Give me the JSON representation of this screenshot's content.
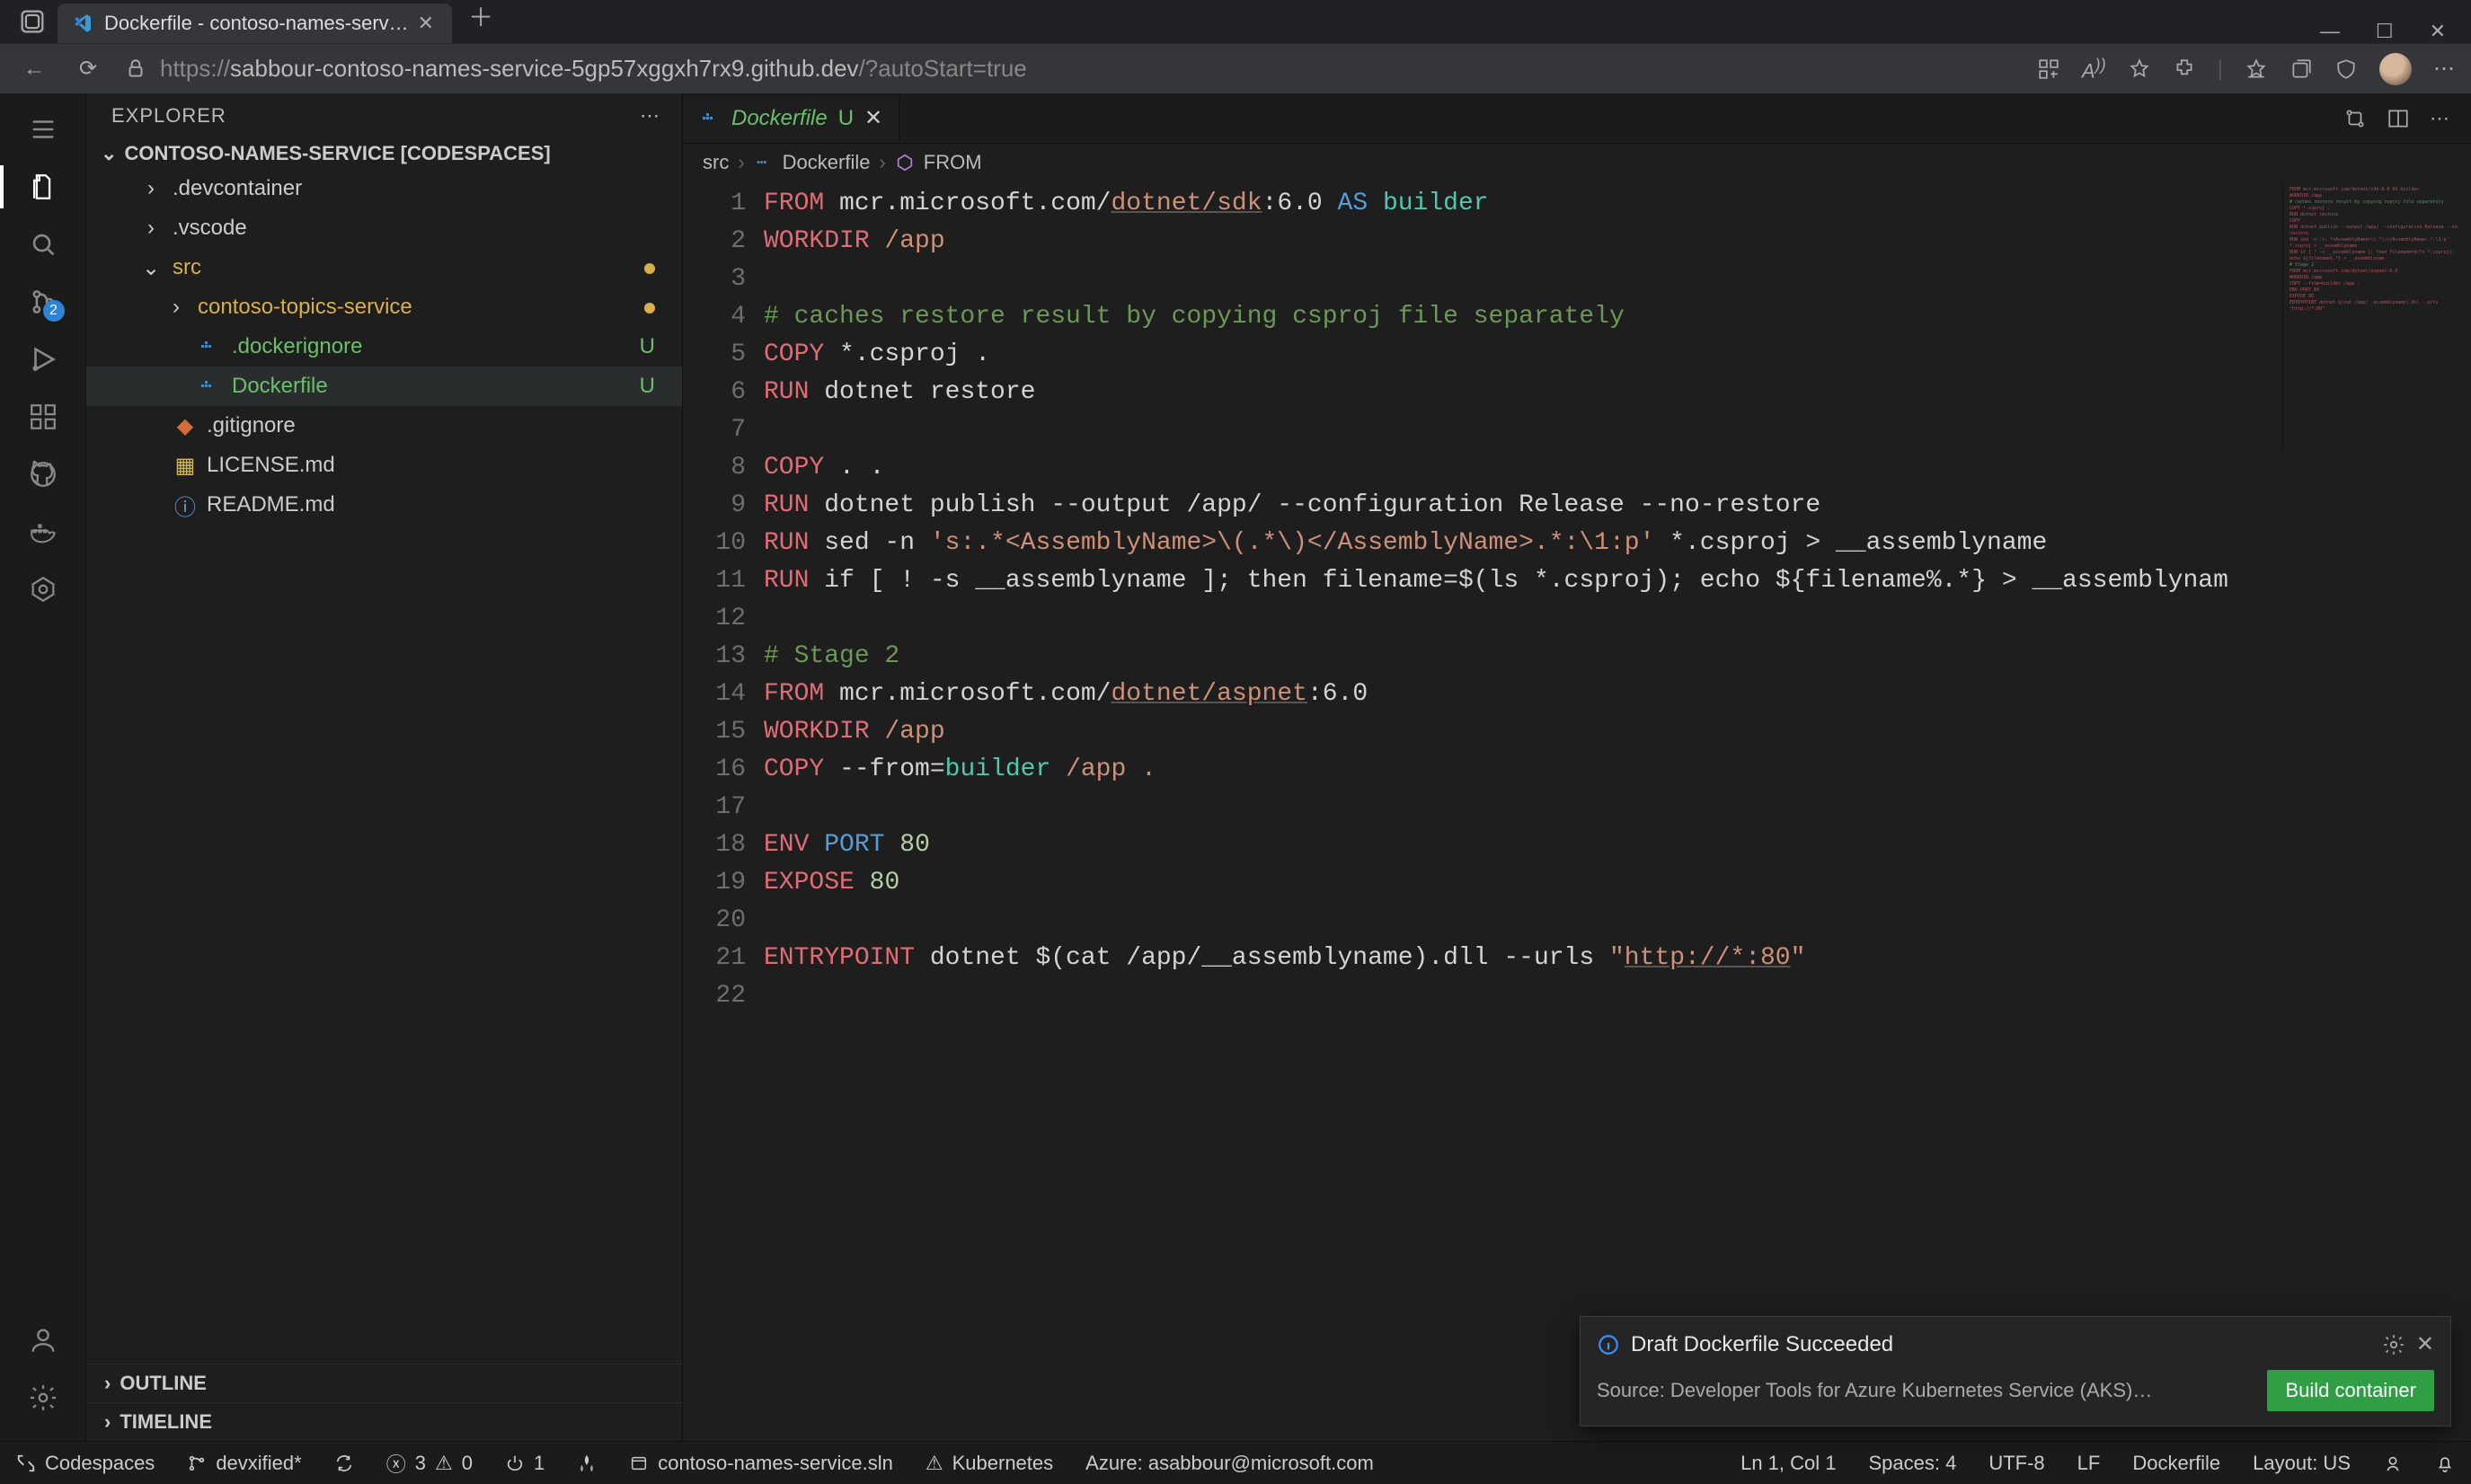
{
  "browser": {
    "tab_title": "Dockerfile - contoso-names-serv…",
    "url_prefix": "https://",
    "url_host": "sabbour-contoso-names-service-5gp57xggxh7rx9.github.dev",
    "url_path": "/?autoStart=true"
  },
  "sidebar": {
    "panel_title": "EXPLORER",
    "workspace_title": "CONTOSO-NAMES-SERVICE [CODESPACES]",
    "outline_label": "OUTLINE",
    "timeline_label": "TIMELINE",
    "tree": [
      {
        "name": ".devcontainer",
        "kind": "dir",
        "depth": 1,
        "expanded": false
      },
      {
        "name": ".vscode",
        "kind": "dir",
        "depth": 1,
        "expanded": false
      },
      {
        "name": "src",
        "kind": "dir",
        "depth": 1,
        "expanded": true,
        "status": "modified",
        "statusGlyph": "dot"
      },
      {
        "name": "contoso-topics-service",
        "kind": "dir",
        "depth": 2,
        "expanded": false,
        "status": "modified",
        "statusGlyph": "dot"
      },
      {
        "name": ".dockerignore",
        "kind": "file",
        "depth": 2,
        "status": "untracked",
        "statusGlyph": "U",
        "icon": "whale"
      },
      {
        "name": "Dockerfile",
        "kind": "file",
        "depth": 2,
        "status": "untracked",
        "statusGlyph": "U",
        "icon": "whale",
        "selected": true
      },
      {
        "name": ".gitignore",
        "kind": "file",
        "depth": 1,
        "icon": "git"
      },
      {
        "name": "LICENSE.md",
        "kind": "file",
        "depth": 1,
        "icon": "cert"
      },
      {
        "name": "README.md",
        "kind": "file",
        "depth": 1,
        "icon": "info"
      }
    ]
  },
  "source_control_badge": "2",
  "editor": {
    "tab_label": "Dockerfile",
    "tab_status": "U",
    "breadcrumb": [
      "src",
      "Dockerfile",
      "FROM"
    ]
  },
  "code": {
    "lines": [
      [
        {
          "t": "FROM",
          "c": "ins"
        },
        {
          "t": " mcr.microsoft.com/",
          "c": "op"
        },
        {
          "t": "dotnet/sdk",
          "c": "lnk"
        },
        {
          "t": ":6.0 ",
          "c": "op"
        },
        {
          "t": "AS",
          "c": "blue"
        },
        {
          "t": " ",
          "c": "op"
        },
        {
          "t": "builder",
          "c": "teal"
        }
      ],
      [
        {
          "t": "WORKDIR",
          "c": "ins"
        },
        {
          "t": " /app",
          "c": "str"
        }
      ],
      [],
      [
        {
          "t": "# caches restore result by copying csproj file separately",
          "c": "cmt"
        }
      ],
      [
        {
          "t": "COPY",
          "c": "ins"
        },
        {
          "t": " *.csproj .",
          "c": "op"
        }
      ],
      [
        {
          "t": "RUN",
          "c": "ins"
        },
        {
          "t": " dotnet restore",
          "c": "op"
        }
      ],
      [],
      [
        {
          "t": "COPY",
          "c": "ins"
        },
        {
          "t": " . .",
          "c": "op"
        }
      ],
      [
        {
          "t": "RUN",
          "c": "ins"
        },
        {
          "t": " dotnet publish --output /app/ --configuration Release --no-restore",
          "c": "op"
        }
      ],
      [
        {
          "t": "RUN",
          "c": "ins"
        },
        {
          "t": " sed -n ",
          "c": "op"
        },
        {
          "t": "'s:.*<AssemblyName>\\(.*\\)</AssemblyName>.*:\\1:p'",
          "c": "str"
        },
        {
          "t": " *.csproj > __assemblyname",
          "c": "op"
        }
      ],
      [
        {
          "t": "RUN",
          "c": "ins"
        },
        {
          "t": " if [ ! -s __assemblyname ]; then filename=$(ls *.csproj); echo ${filename%.*} > __assemblynam",
          "c": "op"
        }
      ],
      [],
      [
        {
          "t": "# Stage 2",
          "c": "cmt"
        }
      ],
      [
        {
          "t": "FROM",
          "c": "ins"
        },
        {
          "t": " mcr.microsoft.com/",
          "c": "op"
        },
        {
          "t": "dotnet/aspnet",
          "c": "lnk"
        },
        {
          "t": ":6.0",
          "c": "op"
        }
      ],
      [
        {
          "t": "WORKDIR",
          "c": "ins"
        },
        {
          "t": " /app",
          "c": "str"
        }
      ],
      [
        {
          "t": "COPY",
          "c": "ins"
        },
        {
          "t": " --from=",
          "c": "op"
        },
        {
          "t": "builder",
          "c": "teal"
        },
        {
          "t": " /app .",
          "c": "str"
        }
      ],
      [],
      [
        {
          "t": "ENV",
          "c": "ins"
        },
        {
          "t": " ",
          "c": "op"
        },
        {
          "t": "PORT",
          "c": "blue"
        },
        {
          "t": " ",
          "c": "op"
        },
        {
          "t": "80",
          "c": "num"
        }
      ],
      [
        {
          "t": "EXPOSE",
          "c": "ins"
        },
        {
          "t": " ",
          "c": "op"
        },
        {
          "t": "80",
          "c": "num"
        }
      ],
      [],
      [
        {
          "t": "ENTRYPOINT",
          "c": "ins"
        },
        {
          "t": " dotnet $(cat /app/__assemblyname).dll --urls ",
          "c": "op"
        },
        {
          "t": "\"",
          "c": "str"
        },
        {
          "t": "http://*:80",
          "c": "lnk"
        },
        {
          "t": "\"",
          "c": "str"
        }
      ],
      []
    ]
  },
  "notification": {
    "title": "Draft Dockerfile Succeeded",
    "source": "Source: Developer Tools for Azure Kubernetes Service (AKS)…",
    "button": "Build container"
  },
  "status_bar": {
    "codespaces": "Codespaces",
    "branch": "devxified*",
    "errors": "3",
    "warnings": "0",
    "ports": "1",
    "solution": "contoso-names-service.sln",
    "kubernetes": "Kubernetes",
    "azure": "Azure: asabbour@microsoft.com",
    "position": "Ln 1, Col 1",
    "spaces": "Spaces: 4",
    "encoding": "UTF-8",
    "eol": "LF",
    "language": "Dockerfile",
    "layout": "Layout: US"
  }
}
